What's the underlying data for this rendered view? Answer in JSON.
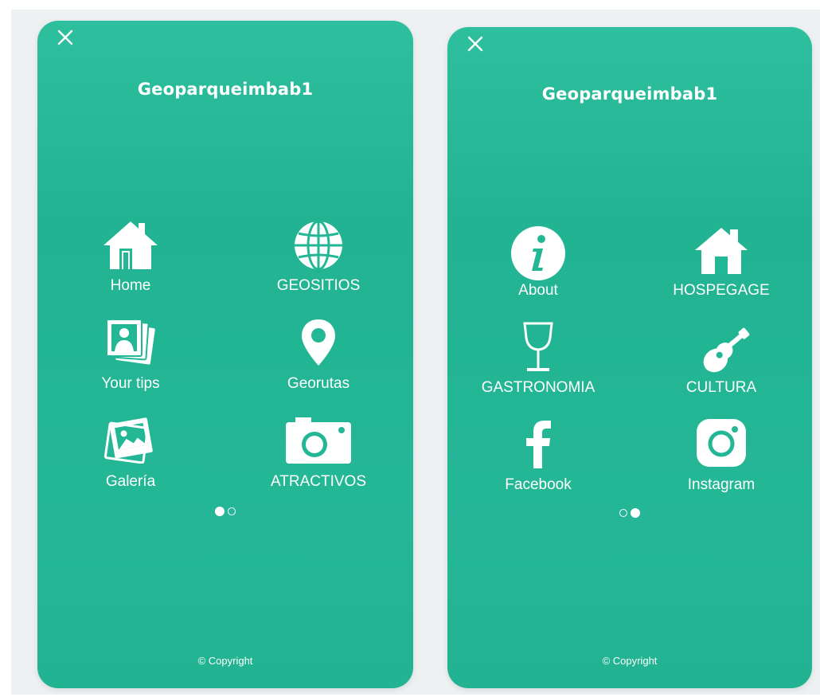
{
  "colors": {
    "accent": "#24b796",
    "text": "#ffffff",
    "background": "#eef1f2"
  },
  "screens": [
    {
      "title": "Geoparqueimbab1",
      "close_icon": "close-icon",
      "menu": [
        {
          "label": "Home",
          "icon": "home-icon"
        },
        {
          "label": "GEOSITIOS",
          "icon": "globe-icon"
        },
        {
          "label": "Your tips",
          "icon": "photos-icon"
        },
        {
          "label": "Georutas",
          "icon": "map-pin-icon"
        },
        {
          "label": "Galería",
          "icon": "gallery-icon"
        },
        {
          "label": "ATRACTIVOS",
          "icon": "camera-icon"
        }
      ],
      "page_indicator": {
        "current": 1,
        "total": 2
      },
      "footer": "© Copyright"
    },
    {
      "title": "Geoparqueimbab1",
      "close_icon": "close-icon",
      "menu": [
        {
          "label": "About",
          "icon": "info-icon"
        },
        {
          "label": "HOSPEGAGE",
          "icon": "house-icon"
        },
        {
          "label": "GASTRONOMIA",
          "icon": "wine-glass-icon"
        },
        {
          "label": "CULTURA",
          "icon": "guitar-icon"
        },
        {
          "label": "Facebook",
          "icon": "facebook-icon"
        },
        {
          "label": "Instagram",
          "icon": "instagram-icon"
        }
      ],
      "page_indicator": {
        "current": 2,
        "total": 2
      },
      "footer": "© Copyright"
    }
  ]
}
